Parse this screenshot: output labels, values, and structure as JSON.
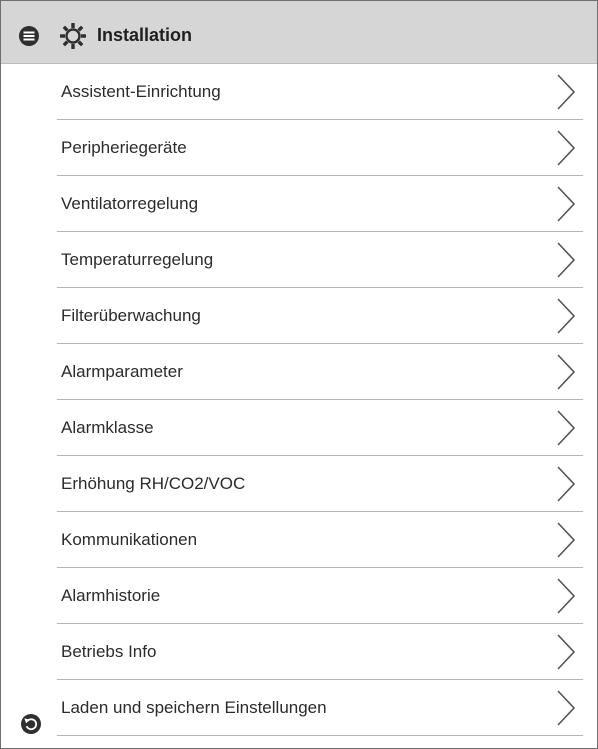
{
  "header": {
    "title": "Installation"
  },
  "menu": {
    "items": [
      {
        "label": "Assistent-Einrichtung"
      },
      {
        "label": "Peripheriegeräte"
      },
      {
        "label": "Ventilatorregelung"
      },
      {
        "label": "Temperaturregelung"
      },
      {
        "label": "Filterüberwachung"
      },
      {
        "label": "Alarmparameter"
      },
      {
        "label": "Alarmklasse"
      },
      {
        "label": "Erhöhung RH/CO2/VOC"
      },
      {
        "label": "Kommunikationen"
      },
      {
        "label": "Alarmhistorie"
      },
      {
        "label": "Betriebs Info"
      },
      {
        "label": "Laden und speichern Einstellungen"
      }
    ]
  },
  "icons": {
    "menu": "menu-icon",
    "settings": "gear-icon",
    "item_arrow": "chevron-right-icon",
    "back": "back-icon"
  },
  "colors": {
    "header_bg": "#d6d6d6",
    "divider": "#b5b5b5",
    "icon": "#2f2f2f"
  }
}
